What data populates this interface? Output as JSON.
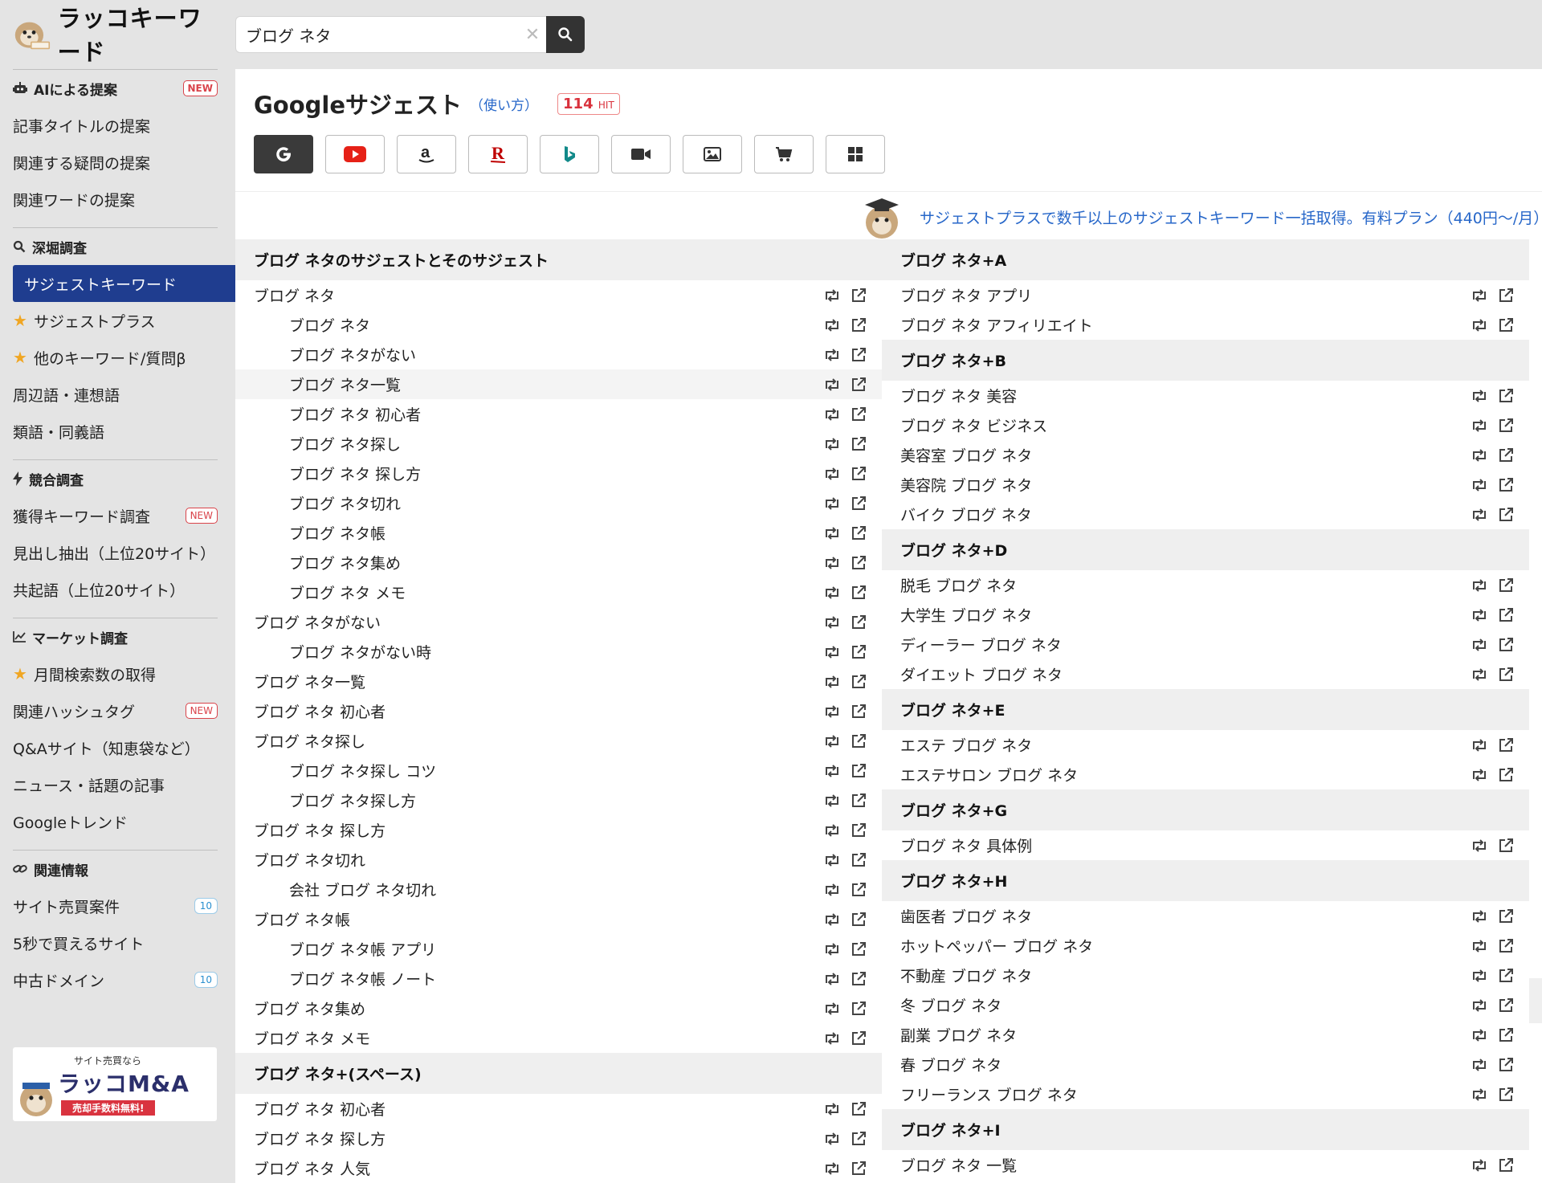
{
  "logo": {
    "text": "ラッコキーワード"
  },
  "search": {
    "value": "ブログ ネタ"
  },
  "sidebar": {
    "sections": [
      {
        "heading": "AIによる提案",
        "heading_badge": "NEW",
        "icon": "robot-icon",
        "items": [
          {
            "label": "記事タイトルの提案"
          },
          {
            "label": "関連する疑問の提案"
          },
          {
            "label": "関連ワードの提案"
          }
        ]
      },
      {
        "heading": "深堀調査",
        "icon": "magnify-icon",
        "items": [
          {
            "label": "サジェストキーワード",
            "active": true
          },
          {
            "label": "サジェストプラス",
            "star": true
          },
          {
            "label": "他のキーワード/質問β",
            "star": true
          },
          {
            "label": "周辺語・連想語"
          },
          {
            "label": "類語・同義語"
          }
        ]
      },
      {
        "heading": "競合調査",
        "icon": "bolt-icon",
        "items": [
          {
            "label": "獲得キーワード調査",
            "badge": "NEW"
          },
          {
            "label": "見出し抽出（上位20サイト）"
          },
          {
            "label": "共起語（上位20サイト）"
          }
        ]
      },
      {
        "heading": "マーケット調査",
        "icon": "chart-line-icon",
        "items": [
          {
            "label": "月間検索数の取得",
            "star": true
          },
          {
            "label": "関連ハッシュタグ",
            "badge": "NEW"
          },
          {
            "label": "Q&Aサイト（知恵袋など）"
          },
          {
            "label": "ニュース・話題の記事"
          },
          {
            "label": "Googleトレンド"
          }
        ]
      },
      {
        "heading": "関連情報",
        "icon": "link-icon",
        "items": [
          {
            "label": "サイト売買案件",
            "count": "10"
          },
          {
            "label": "5秒で買えるサイト"
          },
          {
            "label": "中古ドメイン",
            "count": "10"
          }
        ]
      }
    ],
    "banner": {
      "small": "サイト売買なら",
      "big": "ラッコM&A",
      "ribbon": "売却手数料無料!"
    }
  },
  "main": {
    "title": "Googleサジェスト",
    "howto": "（使い方）",
    "hit_count": "114",
    "hit_unit": "HIT",
    "engines": [
      {
        "name": "google",
        "icon": "google-icon",
        "active": true
      },
      {
        "name": "youtube",
        "icon": "youtube-icon"
      },
      {
        "name": "amazon",
        "icon": "amazon-icon"
      },
      {
        "name": "rakuten",
        "icon": "rakuten-icon"
      },
      {
        "name": "bing",
        "icon": "bing-icon"
      },
      {
        "name": "video",
        "icon": "video-camera-icon"
      },
      {
        "name": "image",
        "icon": "image-icon"
      },
      {
        "name": "shopping",
        "icon": "cart-icon"
      },
      {
        "name": "apps",
        "icon": "grid-icon"
      }
    ],
    "promo": "サジェストプラスで数千以上のサジェストキーワード一括取得。有料プラン（440円〜/月）",
    "left_groups": [
      {
        "heading": "ブログ ネタのサジェストとそのサジェスト",
        "rows": [
          {
            "text": "ブログ ネタ",
            "child": false
          },
          {
            "text": "ブログ ネタ",
            "child": true
          },
          {
            "text": "ブログ ネタがない",
            "child": true
          },
          {
            "text": "ブログ ネタ一覧",
            "child": true,
            "hl": true
          },
          {
            "text": "ブログ ネタ 初心者",
            "child": true
          },
          {
            "text": "ブログ ネタ探し",
            "child": true
          },
          {
            "text": "ブログ ネタ 探し方",
            "child": true
          },
          {
            "text": "ブログ ネタ切れ",
            "child": true
          },
          {
            "text": "ブログ ネタ帳",
            "child": true
          },
          {
            "text": "ブログ ネタ集め",
            "child": true
          },
          {
            "text": "ブログ ネタ メモ",
            "child": true
          },
          {
            "text": "ブログ ネタがない",
            "child": false
          },
          {
            "text": "ブログ ネタがない時",
            "child": true
          },
          {
            "text": "ブログ ネタ一覧",
            "child": false
          },
          {
            "text": "ブログ ネタ 初心者",
            "child": false
          },
          {
            "text": "ブログ ネタ探し",
            "child": false
          },
          {
            "text": "ブログ ネタ探し コツ",
            "child": true
          },
          {
            "text": "ブログ ネタ探し方",
            "child": true
          },
          {
            "text": "ブログ ネタ 探し方",
            "child": false
          },
          {
            "text": "ブログ ネタ切れ",
            "child": false
          },
          {
            "text": "会社 ブログ ネタ切れ",
            "child": true
          },
          {
            "text": "ブログ ネタ帳",
            "child": false
          },
          {
            "text": "ブログ ネタ帳 アプリ",
            "child": true
          },
          {
            "text": "ブログ ネタ帳 ノート",
            "child": true
          },
          {
            "text": "ブログ ネタ集め",
            "child": false
          },
          {
            "text": "ブログ ネタ メモ",
            "child": false
          }
        ]
      },
      {
        "heading": "ブログ ネタ+(スペース)",
        "rows": [
          {
            "text": "ブログ ネタ 初心者",
            "child": false
          },
          {
            "text": "ブログ ネタ 探し方",
            "child": false
          },
          {
            "text": "ブログ ネタ 人気",
            "child": false
          }
        ]
      }
    ],
    "right_groups": [
      {
        "heading": "ブログ ネタ+A",
        "rows": [
          {
            "text": "ブログ ネタ アプリ"
          },
          {
            "text": "ブログ ネタ アフィリエイト"
          }
        ]
      },
      {
        "heading": "ブログ ネタ+B",
        "rows": [
          {
            "text": "ブログ ネタ 美容"
          },
          {
            "text": "ブログ ネタ ビジネス"
          },
          {
            "text": "美容室 ブログ ネタ"
          },
          {
            "text": "美容院 ブログ ネタ"
          },
          {
            "text": "バイク ブログ ネタ"
          }
        ]
      },
      {
        "heading": "ブログ ネタ+D",
        "rows": [
          {
            "text": "脱毛 ブログ ネタ"
          },
          {
            "text": "大学生 ブログ ネタ"
          },
          {
            "text": "ディーラー ブログ ネタ"
          },
          {
            "text": "ダイエット ブログ ネタ"
          }
        ]
      },
      {
        "heading": "ブログ ネタ+E",
        "rows": [
          {
            "text": "エステ ブログ ネタ"
          },
          {
            "text": "エステサロン ブログ ネタ"
          }
        ]
      },
      {
        "heading": "ブログ ネタ+G",
        "rows": [
          {
            "text": "ブログ ネタ 具体例"
          }
        ]
      },
      {
        "heading": "ブログ ネタ+H",
        "rows": [
          {
            "text": "歯医者 ブログ ネタ"
          },
          {
            "text": "ホットペッパー ブログ ネタ"
          },
          {
            "text": "不動産 ブログ ネタ"
          },
          {
            "text": "冬 ブログ ネタ"
          },
          {
            "text": "副業 ブログ ネタ"
          },
          {
            "text": "春 ブログ ネタ"
          },
          {
            "text": "フリーランス ブログ ネタ"
          }
        ]
      },
      {
        "heading": "ブログ ネタ+I",
        "rows": [
          {
            "text": "ブログ ネタ 一覧"
          }
        ]
      }
    ]
  }
}
